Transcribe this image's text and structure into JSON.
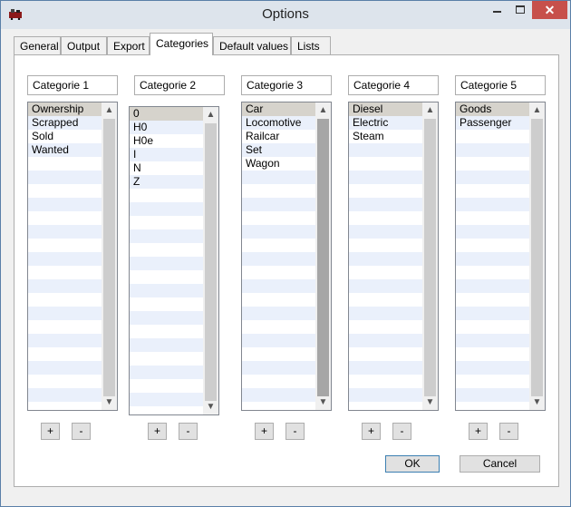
{
  "window": {
    "title": "Options",
    "close_glyph": "✕"
  },
  "tabs": [
    {
      "label": "General"
    },
    {
      "label": "Output"
    },
    {
      "label": "Export"
    },
    {
      "label": "Categories",
      "active": true
    },
    {
      "label": "Default values"
    },
    {
      "label": "Lists"
    }
  ],
  "categories": [
    {
      "header": "Categorie 1",
      "items": [
        "Ownership",
        "Scrapped",
        "Sold",
        "Wanted"
      ]
    },
    {
      "header": "Categorie 2",
      "items": [
        "0",
        "H0",
        "H0e",
        "I",
        "N",
        "Z"
      ]
    },
    {
      "header": "Categorie 3",
      "items": [
        "Car",
        "Locomotive",
        "Railcar",
        "Set",
        "Wagon"
      ]
    },
    {
      "header": "Categorie 4",
      "items": [
        "Diesel",
        "Electric",
        "Steam"
      ]
    },
    {
      "header": "Categorie 5",
      "items": [
        "Goods",
        "Passenger"
      ]
    }
  ],
  "list_buttons": {
    "add_label": "+",
    "remove_label": "-"
  },
  "dialog_buttons": {
    "ok_label": "OK",
    "cancel_label": "Cancel"
  },
  "icons": {
    "app": "locomotive-icon",
    "scroll_up": "▲",
    "scroll_down": "▼"
  },
  "colors": {
    "close_button": "#c7504b",
    "stripe": "#eaf0fb",
    "selection": "#d6d3cc"
  }
}
